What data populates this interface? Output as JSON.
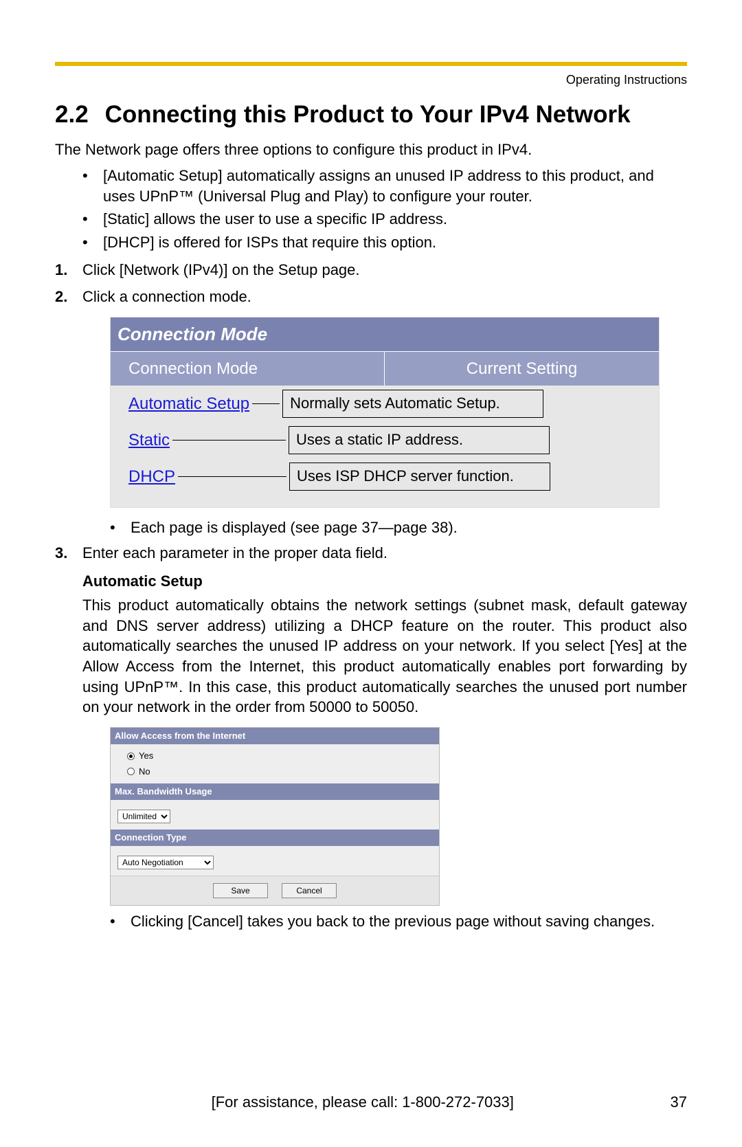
{
  "header": {
    "doc_label": "Operating Instructions"
  },
  "section": {
    "number": "2.2",
    "title": "Connecting this Product to Your IPv4 Network",
    "intro": "The Network page offers three options to configure this product in IPv4.",
    "bullets": [
      "[Automatic Setup] automatically assigns an unused IP address to this product, and uses UPnP™ (Universal Plug and Play) to configure your router.",
      "[Static] allows the user to use a specific IP address.",
      "[DHCP] is offered for ISPs that require this option."
    ]
  },
  "steps": {
    "s1": "Click [Network (IPv4)] on the Setup page.",
    "s2": "Click a connection mode.",
    "s2_note": "Each page is displayed (see page 37—page 38).",
    "s3": "Enter each parameter in the proper data field."
  },
  "conn_table": {
    "title": "Connection Mode",
    "col1": "Connection Mode",
    "col2": "Current Setting",
    "rows": [
      {
        "link": "Automatic Setup",
        "desc": "Normally sets Automatic Setup."
      },
      {
        "link": "Static",
        "desc": "Uses a static IP address."
      },
      {
        "link": "DHCP",
        "desc": "Uses ISP DHCP server function."
      }
    ]
  },
  "auto_setup": {
    "heading": "Automatic Setup",
    "para": "This product automatically obtains the network settings (subnet mask, default gateway and DNS server address) utilizing a DHCP feature on the router. This product also automatically searches the unused IP address on your network. If you select [Yes] at the Allow Access from the Internet, this product automatically enables port forwarding by using UPnP™. In this case, this product automatically searches the unused port number on your network in the order from 50000 to 50050."
  },
  "settings_panel": {
    "allow_hdr": "Allow Access from the Internet",
    "yes": "Yes",
    "no": "No",
    "bw_hdr": "Max. Bandwidth Usage",
    "bw_value": "Unlimited",
    "conn_hdr": "Connection Type",
    "conn_value": "Auto Negotiation",
    "save": "Save",
    "cancel": "Cancel"
  },
  "post_note": "Clicking [Cancel] takes you back to the previous page without saving changes.",
  "footer": {
    "assist": "[For assistance, please call: 1-800-272-7033]",
    "page": "37"
  }
}
